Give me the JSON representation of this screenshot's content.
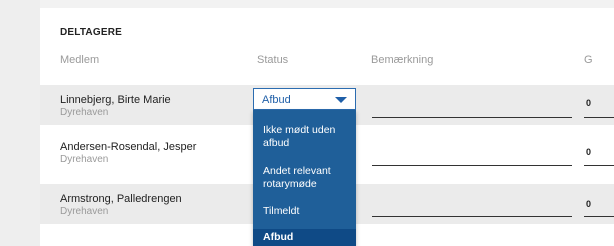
{
  "section": {
    "title": "DELTAGERE"
  },
  "columns": {
    "member": "Medlem",
    "status": "Status",
    "note": "Bemærkning",
    "g": "G"
  },
  "rows": [
    {
      "name": "Linnebjerg, Birte Marie",
      "club": "Dyrehaven",
      "g": "0"
    },
    {
      "name": "Andersen-Rosendal, Jesper",
      "club": "Dyrehaven",
      "g": "0"
    },
    {
      "name": "Armstrong, Palledrengen",
      "club": "Dyrehaven",
      "g": "0"
    }
  ],
  "status_dropdown": {
    "value": "Afbud",
    "options": [
      "Ikke mødt uden afbud",
      "Andet relevant rotarymøde",
      "Tilmeldt",
      "Afbud"
    ],
    "selected": "Afbud"
  },
  "colors": {
    "accent": "#1f5fa8",
    "menu_bg": "#1f5f99",
    "menu_selected": "#0f4a86",
    "row_alt": "#ebebeb"
  }
}
